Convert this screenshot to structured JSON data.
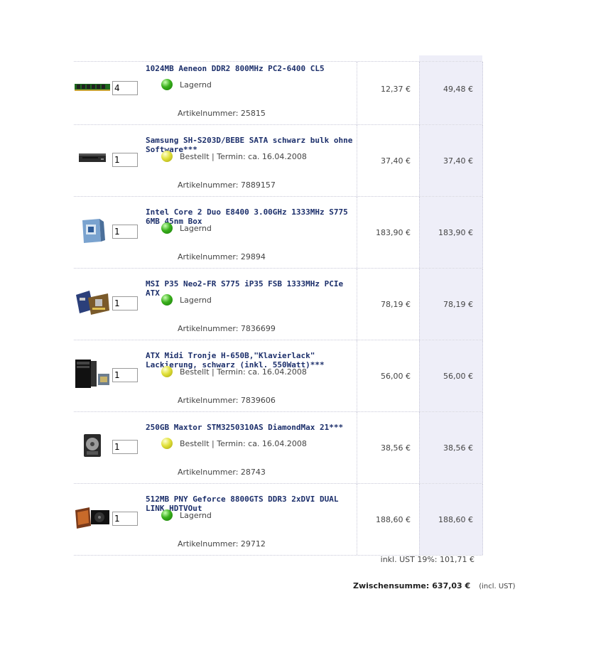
{
  "cart": {
    "items": [
      {
        "title": "1024MB Aeneon DDR2 800MHz PC2-6400 CL5",
        "qty": "4",
        "status": "Lagernd",
        "status_color": "green",
        "article_label": "Artikelnummer: 25815",
        "unit_price": "12,37 €",
        "total_price": "49,48 €",
        "icon": "ram-module-icon"
      },
      {
        "title": "Samsung SH-S203D/BEBE SATA schwarz bulk ohne Software***",
        "qty": "1",
        "status": "Bestellt | Termin: ca. 16.04.2008",
        "status_color": "yellow",
        "article_label": "Artikelnummer: 7889157",
        "unit_price": "37,40 €",
        "total_price": "37,40 €",
        "icon": "optical-drive-icon"
      },
      {
        "title": "Intel Core 2 Duo E8400 3.00GHz 1333MHz S775 6MB 45nm Box",
        "qty": "1",
        "status": "Lagernd",
        "status_color": "green",
        "article_label": "Artikelnummer: 29894",
        "unit_price": "183,90 €",
        "total_price": "183,90 €",
        "icon": "cpu-box-icon"
      },
      {
        "title": "MSI P35 Neo2-FR S775 iP35 FSB 1333MHz PCIe ATX",
        "qty": "1",
        "status": "Lagernd",
        "status_color": "green",
        "article_label": "Artikelnummer: 7836699",
        "unit_price": "78,19 €",
        "total_price": "78,19 €",
        "icon": "motherboard-icon"
      },
      {
        "title": "ATX Midi Tronje H-650B,\"Klavierlack\" Lackierung, schwarz (inkl. 550Watt)***",
        "qty": "1",
        "status": "Bestellt | Termin: ca. 16.04.2008",
        "status_color": "yellow",
        "article_label": "Artikelnummer: 7839606",
        "unit_price": "56,00 €",
        "total_price": "56,00 €",
        "icon": "pc-case-icon"
      },
      {
        "title": "250GB Maxtor STM3250310AS DiamondMax 21***",
        "qty": "1",
        "status": "Bestellt | Termin: ca. 16.04.2008",
        "status_color": "yellow",
        "article_label": "Artikelnummer: 28743",
        "unit_price": "38,56 €",
        "total_price": "38,56 €",
        "icon": "hard-drive-icon"
      },
      {
        "title": "512MB PNY Geforce 8800GTS DDR3 2xDVI DUAL LINK HDTVOut",
        "qty": "1",
        "status": "Lagernd",
        "status_color": "green",
        "article_label": "Artikelnummer: 29712",
        "unit_price": "188,60 €",
        "total_price": "188,60 €",
        "icon": "graphics-card-icon"
      }
    ],
    "vat_line": "inkl. UST 19%: 101,71 €",
    "subtotal_label": "Zwischensumme:",
    "subtotal_value": "637,03 €",
    "subtotal_note": "(incl. UST)"
  },
  "colors": {
    "title": "#1c2f6b",
    "total_column_bg": "#eeeef8",
    "status_green": "#3ab01c",
    "status_yellow": "#e1e13a"
  }
}
